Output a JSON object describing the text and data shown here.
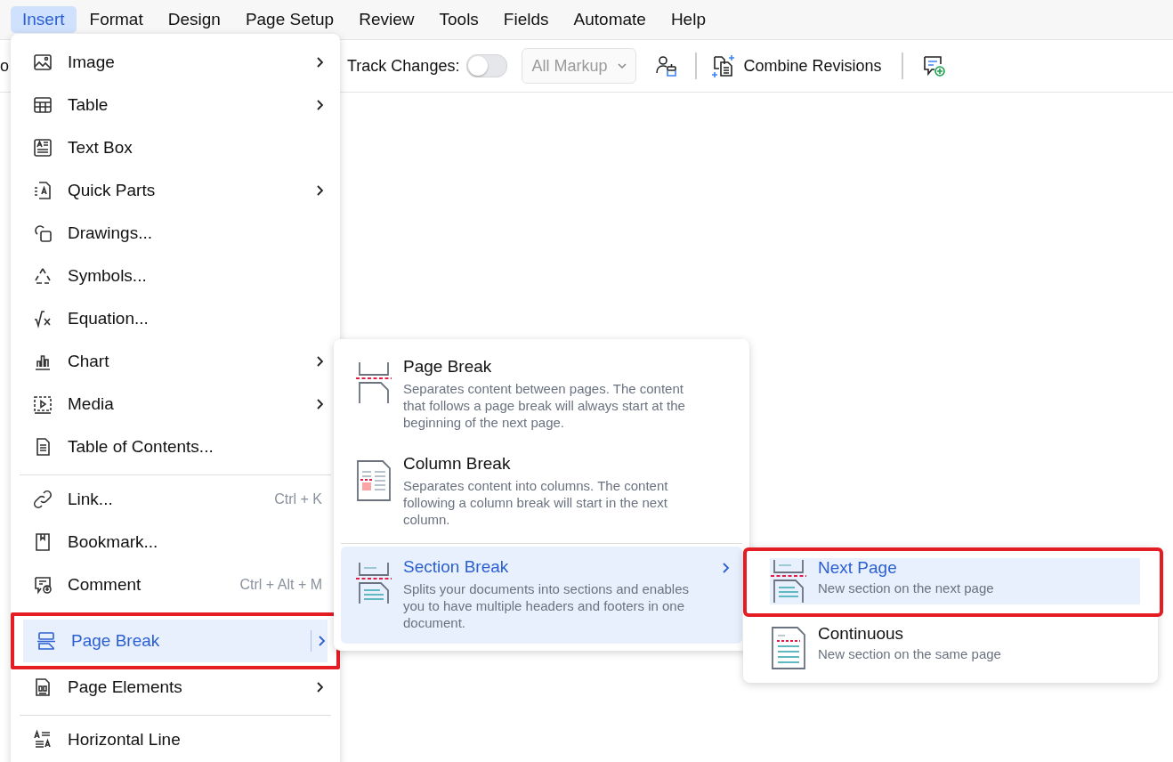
{
  "menubar": [
    {
      "label": "Insert",
      "selected": true
    },
    {
      "label": "Format",
      "selected": false
    },
    {
      "label": "Design",
      "selected": false
    },
    {
      "label": "Page Setup",
      "selected": false
    },
    {
      "label": "Review",
      "selected": false
    },
    {
      "label": "Tools",
      "selected": false
    },
    {
      "label": "Fields",
      "selected": false
    },
    {
      "label": "Automate",
      "selected": false
    },
    {
      "label": "Help",
      "selected": false
    }
  ],
  "toolbar": {
    "cut_text": "o",
    "track_changes": {
      "label": "Track Changes:",
      "on": false
    },
    "markup": {
      "value": "All Markup",
      "disabled": true
    },
    "combine": "Combine Revisions"
  },
  "insert_menu": {
    "items": [
      {
        "kind": "item",
        "label": "Image",
        "submenu": true,
        "selected": false,
        "highlighted": false
      },
      {
        "kind": "item",
        "label": "Table",
        "submenu": true,
        "selected": false,
        "highlighted": false
      },
      {
        "kind": "item",
        "label": "Text Box",
        "submenu": false,
        "selected": false,
        "highlighted": false
      },
      {
        "kind": "item",
        "label": "Quick Parts",
        "submenu": true,
        "selected": false,
        "highlighted": false
      },
      {
        "kind": "item",
        "label": "Drawings...",
        "submenu": false,
        "selected": false,
        "highlighted": false
      },
      {
        "kind": "item",
        "label": "Symbols...",
        "submenu": false,
        "selected": false,
        "highlighted": false
      },
      {
        "kind": "item",
        "label": "Equation...",
        "submenu": false,
        "selected": false,
        "highlighted": false
      },
      {
        "kind": "item",
        "label": "Chart",
        "submenu": true,
        "selected": false,
        "highlighted": false
      },
      {
        "kind": "item",
        "label": "Media",
        "submenu": true,
        "selected": false,
        "highlighted": false
      },
      {
        "kind": "item",
        "label": "Table of Contents...",
        "submenu": false,
        "selected": false,
        "highlighted": false
      },
      {
        "kind": "divider"
      },
      {
        "kind": "item",
        "label": "Link...",
        "shortcut": "Ctrl + K",
        "submenu": false,
        "selected": false,
        "highlighted": false
      },
      {
        "kind": "item",
        "label": "Bookmark...",
        "submenu": false,
        "selected": false,
        "highlighted": false
      },
      {
        "kind": "item",
        "label": "Comment",
        "shortcut": "Ctrl + Alt + M",
        "submenu": false,
        "selected": false,
        "highlighted": false
      },
      {
        "kind": "divider"
      },
      {
        "kind": "item",
        "label": "Page Break",
        "submenu": true,
        "selected": true,
        "highlighted": true
      },
      {
        "kind": "item",
        "label": "Page Elements",
        "submenu": true,
        "selected": false,
        "highlighted": false
      },
      {
        "kind": "divider"
      },
      {
        "kind": "item",
        "label": "Horizontal Line",
        "submenu": false,
        "selected": false,
        "highlighted": false
      }
    ]
  },
  "page_break_menu": {
    "items": [
      {
        "title": "Page Break",
        "description": "Separates content between pages. The content that follows a page break will always start at the beginning of the next page.",
        "submenu": false,
        "selected": false
      },
      {
        "title": "Column Break",
        "description": "Separates content into columns. The content following a column break will start in the next column.",
        "submenu": false,
        "selected": false
      },
      {
        "title": "Section Break",
        "description": "Splits your documents into sections and enables you to have multiple headers and footers in one document.",
        "submenu": true,
        "selected": true
      }
    ]
  },
  "section_break_menu": {
    "items": [
      {
        "title": "Next Page",
        "description": "New section on the next page",
        "selected": true,
        "highlighted": true
      },
      {
        "title": "Continuous",
        "description": "New section on the same page",
        "selected": false,
        "highlighted": false
      }
    ]
  }
}
